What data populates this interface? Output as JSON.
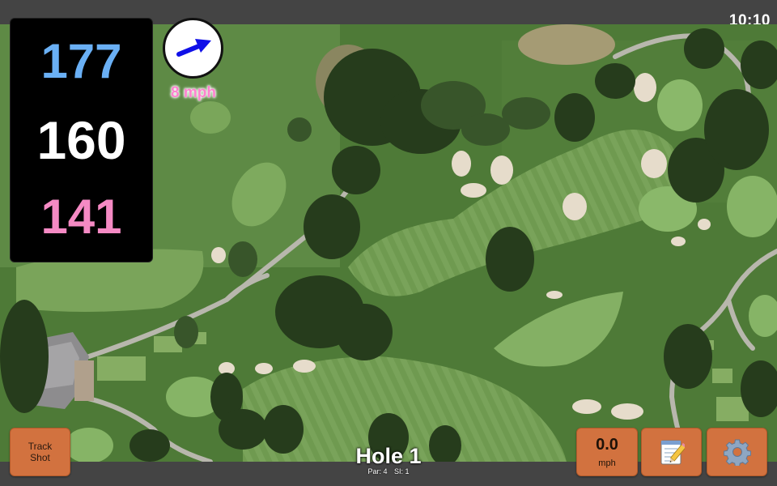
{
  "status": {
    "clock": "10:10"
  },
  "distances": {
    "back": "177",
    "middle": "160",
    "front": "141"
  },
  "wind": {
    "speed": "8 mph",
    "icon": "wind-arrow-icon"
  },
  "hole": {
    "title": "Hole 1",
    "par": "Par: 4",
    "stroke_index": "SI: 1"
  },
  "buttons": {
    "track_line1": "Track",
    "track_line2": "Shot",
    "speed_value": "0.0",
    "speed_unit": "mph",
    "notes_icon": "notepad-icon",
    "settings_icon": "gear-icon"
  },
  "colors": {
    "back_distance": "#6ab0f5",
    "middle_distance": "#ffffff",
    "front_distance": "#f58ac4",
    "wind_text": "#ff82cf",
    "button_bg": "#d2723f"
  }
}
